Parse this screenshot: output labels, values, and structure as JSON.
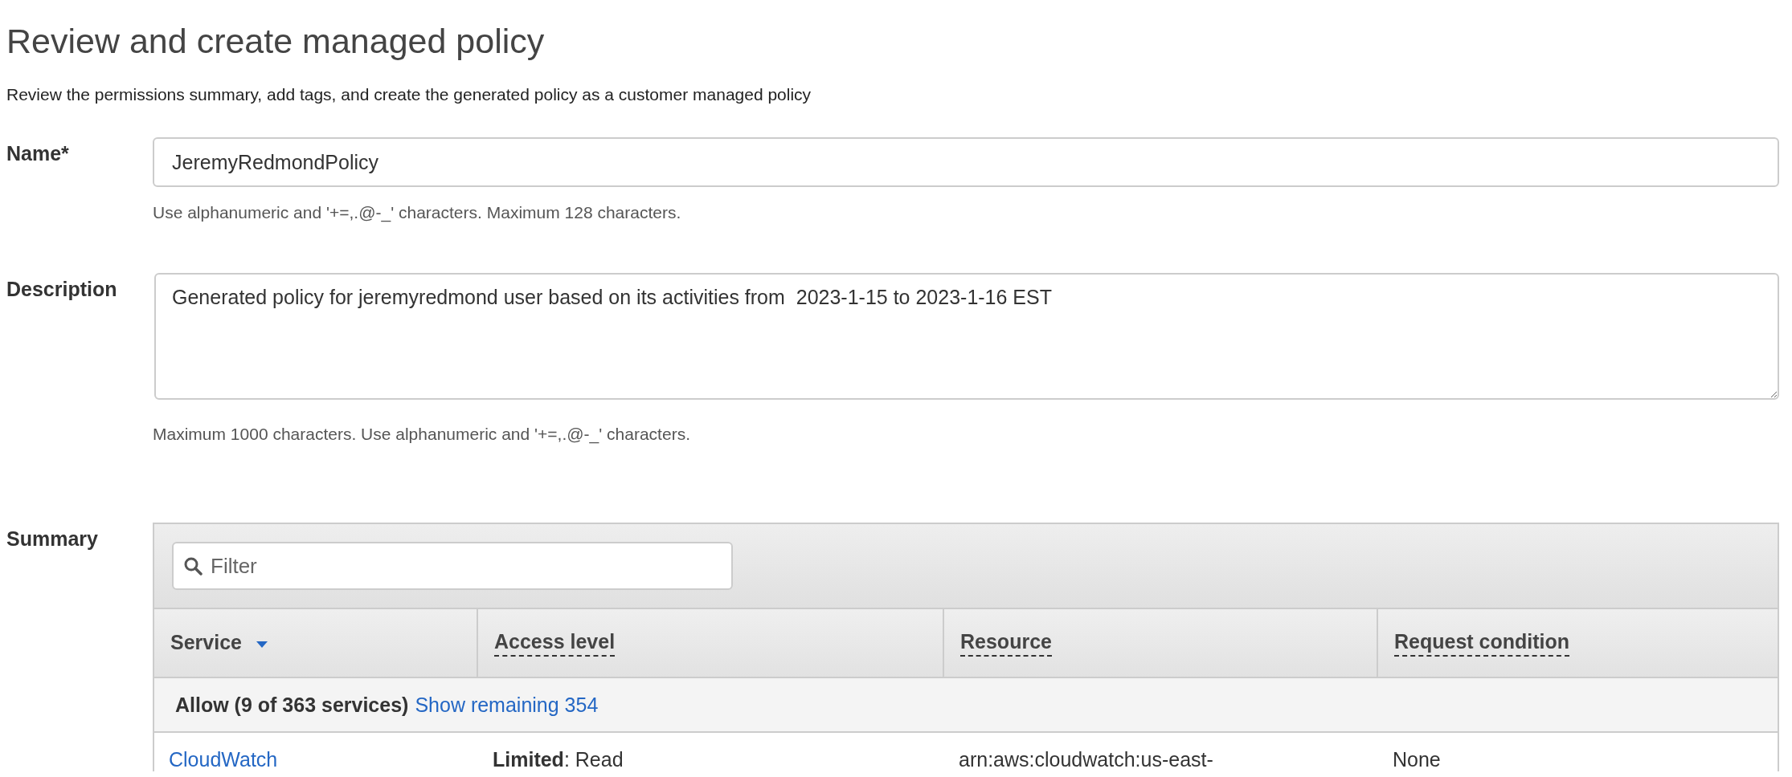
{
  "page": {
    "title": "Review and create managed policy",
    "subtitle": "Review the permissions summary, add tags, and create the generated policy as a customer managed policy"
  },
  "name_field": {
    "label": "Name*",
    "value": "JeremyRedmondPolicy",
    "hint": "Use alphanumeric and '+=,.@-_' characters. Maximum 128 characters."
  },
  "description_field": {
    "label": "Description",
    "value": "Generated policy for jeremyredmond user based on its activities from  2023-1-15 to 2023-1-16 EST",
    "hint": "Maximum 1000 characters. Use alphanumeric and '+=,.@-_' characters."
  },
  "summary": {
    "label": "Summary",
    "filter": {
      "placeholder": "Filter"
    },
    "columns": [
      {
        "label": "Service",
        "sorted": true,
        "hint": false
      },
      {
        "label": "Access level",
        "sorted": false,
        "hint": true
      },
      {
        "label": "Resource",
        "sorted": false,
        "hint": true
      },
      {
        "label": "Request condition",
        "sorted": false,
        "hint": true
      }
    ],
    "group": {
      "label": "Allow (9 of 363 services)",
      "link": "Show remaining 354"
    },
    "rows": [
      {
        "service": "CloudWatch",
        "access_level": "**Limited**: Read",
        "resource": "arn:aws:cloudwatch:us-east-",
        "condition": "None"
      }
    ]
  }
}
